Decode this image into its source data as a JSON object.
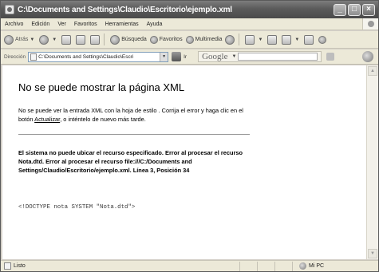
{
  "window": {
    "title": "C:\\Documents and Settings\\Claudio\\Escritorio\\ejemplo.xml",
    "controls": [
      "_",
      "□",
      "×"
    ]
  },
  "menubar": {
    "items": [
      "Archivo",
      "Edición",
      "Ver",
      "Favoritos",
      "Herramientas",
      "Ayuda"
    ]
  },
  "toolbar": {
    "back_label": "Atrás",
    "search_label": "Búsqueda",
    "favorites_label": "Favoritos",
    "multimedia_label": "Multimedia"
  },
  "addressbar": {
    "label": "Dirección",
    "value": "C:\\Documents and Settings\\Claudio\\Escri",
    "go_label": "Ir",
    "google_label": "Google"
  },
  "content": {
    "title": "No se puede mostrar la página XML",
    "description_before": "No se puede ver la entrada XML con la hoja de estilo . Corrija el error y haga clic en el botón ",
    "description_link": "Actualizar",
    "description_after": ", o inténtelo de nuevo más tarde.",
    "detail": "El sistema no puede ubicar el recurso especificado. Error al procesar el recurso Nota.dtd. Error al procesar el recurso file:///C:/Documents and Settings/Claudio/Escritorio/ejemplo.xml. Línea 3, Posición 34",
    "source_line": "<!DOCTYPE nota SYSTEM \"Nota.dtd\">"
  },
  "statusbar": {
    "status": "Listo",
    "zone": "Mi PC"
  }
}
